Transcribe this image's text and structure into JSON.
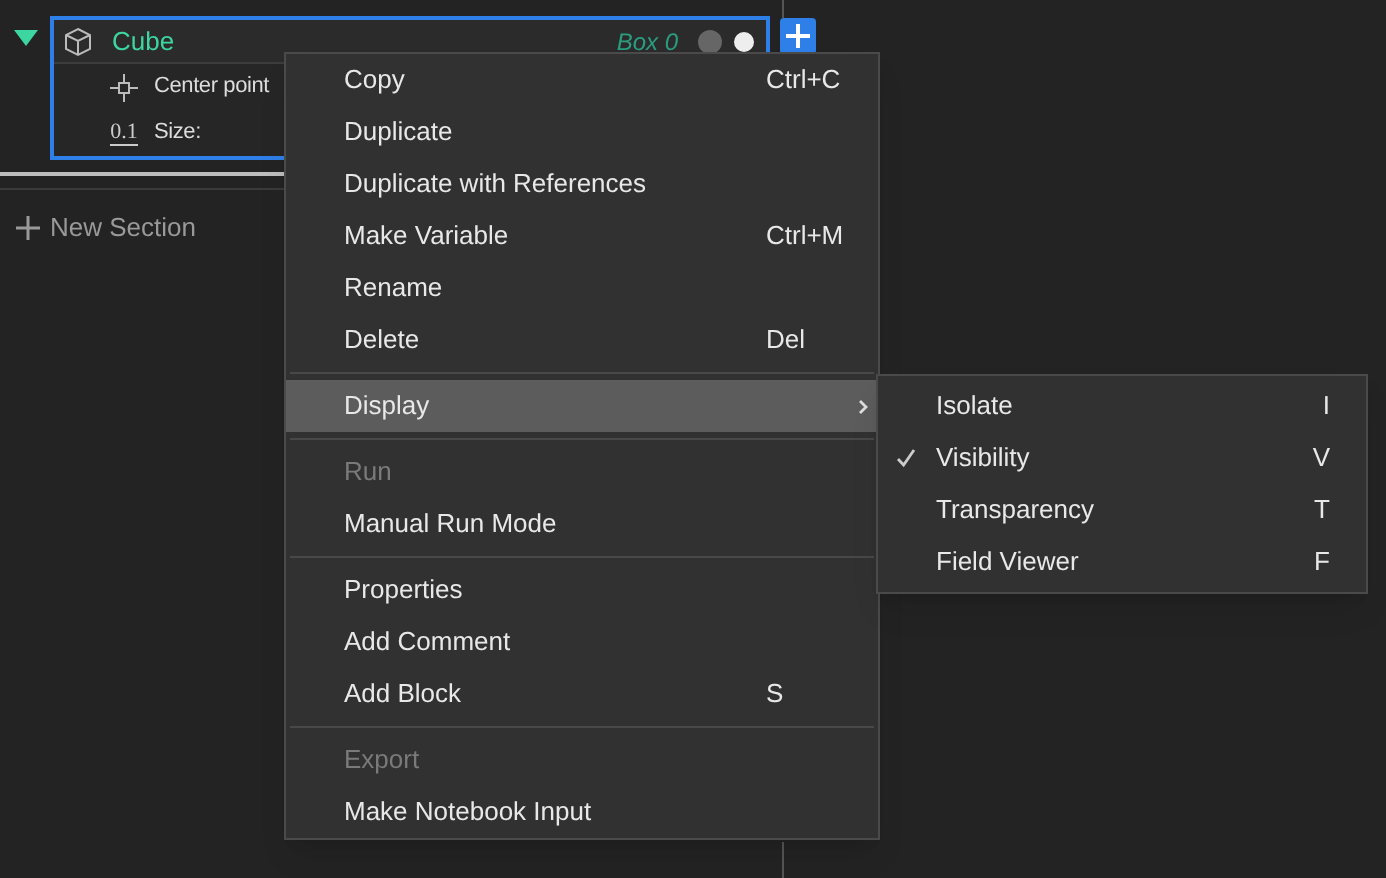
{
  "block": {
    "name": "Cube",
    "type_label": "Box 0",
    "expanded": true,
    "selected": true,
    "inputs": [
      {
        "kind": "point",
        "label": "Center point"
      },
      {
        "kind": "number",
        "label": "Size:",
        "icon_label": "0.1"
      }
    ]
  },
  "add_section": {
    "label": "New Section"
  },
  "context_menu": {
    "groups": [
      [
        {
          "label": "Copy",
          "shortcut": "Ctrl+C",
          "disabled": false,
          "highlighted": false,
          "submenu": false
        },
        {
          "label": "Duplicate",
          "disabled": false,
          "highlighted": false,
          "submenu": false
        },
        {
          "label": "Duplicate with References",
          "disabled": false,
          "highlighted": false,
          "submenu": false
        },
        {
          "label": "Make Variable",
          "shortcut": "Ctrl+M",
          "disabled": false,
          "highlighted": false,
          "submenu": false
        },
        {
          "label": "Rename",
          "disabled": false,
          "highlighted": false,
          "submenu": false
        },
        {
          "label": "Delete",
          "shortcut": "Del",
          "disabled": false,
          "highlighted": false,
          "submenu": false
        }
      ],
      [
        {
          "label": "Display",
          "disabled": false,
          "highlighted": true,
          "submenu": true
        }
      ],
      [
        {
          "label": "Run",
          "disabled": true,
          "highlighted": false,
          "submenu": false
        },
        {
          "label": "Manual Run Mode",
          "disabled": false,
          "highlighted": false,
          "submenu": false
        }
      ],
      [
        {
          "label": "Properties",
          "disabled": false,
          "highlighted": false,
          "submenu": false
        },
        {
          "label": "Add Comment",
          "disabled": false,
          "highlighted": false,
          "submenu": false
        },
        {
          "label": "Add Block",
          "shortcut": "S",
          "disabled": false,
          "highlighted": false,
          "submenu": false
        }
      ],
      [
        {
          "label": "Export",
          "disabled": true,
          "highlighted": false,
          "submenu": false
        },
        {
          "label": "Make Notebook Input",
          "disabled": false,
          "highlighted": false,
          "submenu": false
        }
      ]
    ]
  },
  "submenu": {
    "items": [
      {
        "label": "Isolate",
        "shortcut": "I",
        "checked": false
      },
      {
        "label": "Visibility",
        "shortcut": "V",
        "checked": true
      },
      {
        "label": "Transparency",
        "shortcut": "T",
        "checked": false
      },
      {
        "label": "Field Viewer",
        "shortcut": "F",
        "checked": false
      }
    ]
  }
}
